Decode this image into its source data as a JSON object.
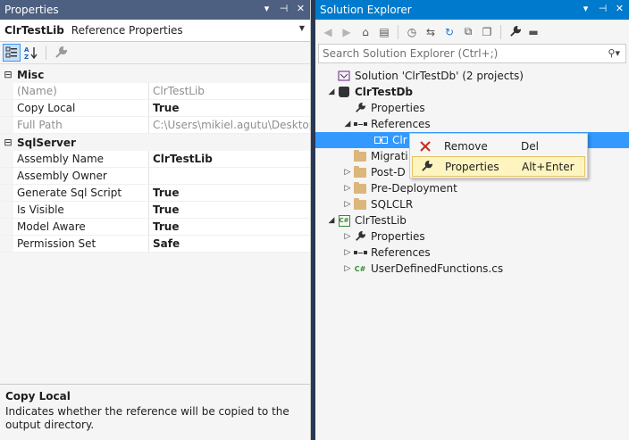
{
  "properties": {
    "title": "Properties",
    "title_buttons": [
      "▾",
      "⊣",
      "✕"
    ],
    "object_name": "ClrTestLib",
    "object_type": "Reference Properties",
    "categories": [
      {
        "name": "Misc",
        "expander": "⊟",
        "rows": [
          {
            "name": "(Name)",
            "value": "ClrTestLib",
            "readonly": true
          },
          {
            "name": "Copy Local",
            "value": "True",
            "readonly": false
          },
          {
            "name": "Full Path",
            "value": "C:\\Users\\mikiel.agutu\\Desktop\\C",
            "readonly": true
          }
        ]
      },
      {
        "name": "SqlServer",
        "expander": "⊟",
        "rows": [
          {
            "name": "Assembly Name",
            "value": "ClrTestLib",
            "readonly": false
          },
          {
            "name": "Assembly Owner",
            "value": "",
            "readonly": false
          },
          {
            "name": "Generate Sql Script",
            "value": "True",
            "readonly": false
          },
          {
            "name": "Is Visible",
            "value": "True",
            "readonly": false
          },
          {
            "name": "Model Aware",
            "value": "True",
            "readonly": false
          },
          {
            "name": "Permission Set",
            "value": "Safe",
            "readonly": false
          }
        ]
      }
    ],
    "description": {
      "heading": "Copy Local",
      "body": "Indicates whether the reference will be copied to the output directory."
    }
  },
  "solution_explorer": {
    "title": "Solution Explorer",
    "title_buttons": [
      "▾",
      "⊣",
      "✕"
    ],
    "search_placeholder": "Search Solution Explorer (Ctrl+;)",
    "tree": [
      {
        "label": "Solution 'ClrTestDb' (2 projects)",
        "depth": 0,
        "arrow": "",
        "icon": "solution-icon"
      },
      {
        "label": "ClrTestDb",
        "depth": 1,
        "arrow": "◢",
        "icon": "database-project-icon",
        "bold": true
      },
      {
        "label": "Properties",
        "depth": 2,
        "arrow": "",
        "icon": "wrench-icon"
      },
      {
        "label": "References",
        "depth": 2,
        "arrow": "◢",
        "icon": "references-icon"
      },
      {
        "label": "Clr",
        "depth": 3,
        "arrow": "",
        "icon": "assembly-reference-icon",
        "selected": true
      },
      {
        "label": "Migrati",
        "depth": 2,
        "arrow": "",
        "icon": "folder-icon"
      },
      {
        "label": "Post-D",
        "depth": 2,
        "arrow": "▷",
        "icon": "folder-icon"
      },
      {
        "label": "Pre-Deployment",
        "depth": 2,
        "arrow": "▷",
        "icon": "folder-icon"
      },
      {
        "label": "SQLCLR",
        "depth": 2,
        "arrow": "▷",
        "icon": "folder-icon"
      },
      {
        "label": "ClrTestLib",
        "depth": 1,
        "arrow": "◢",
        "icon": "csharp-project-icon"
      },
      {
        "label": "Properties",
        "depth": 2,
        "arrow": "▷",
        "icon": "wrench-icon"
      },
      {
        "label": "References",
        "depth": 2,
        "arrow": "▷",
        "icon": "references-icon"
      },
      {
        "label": "UserDefinedFunctions.cs",
        "depth": 2,
        "arrow": "▷",
        "icon": "csharp-file-icon"
      }
    ]
  },
  "context_menu": {
    "items": [
      {
        "label": "Remove",
        "shortcut": "Del",
        "icon": "remove-icon"
      },
      {
        "label": "Properties",
        "shortcut": "Alt+Enter",
        "icon": "wrench-icon",
        "highlighted": true
      }
    ]
  },
  "colors": {
    "accent": "#007acc",
    "selection": "#3399ff",
    "menu_highlight": "#fdf4bf"
  }
}
